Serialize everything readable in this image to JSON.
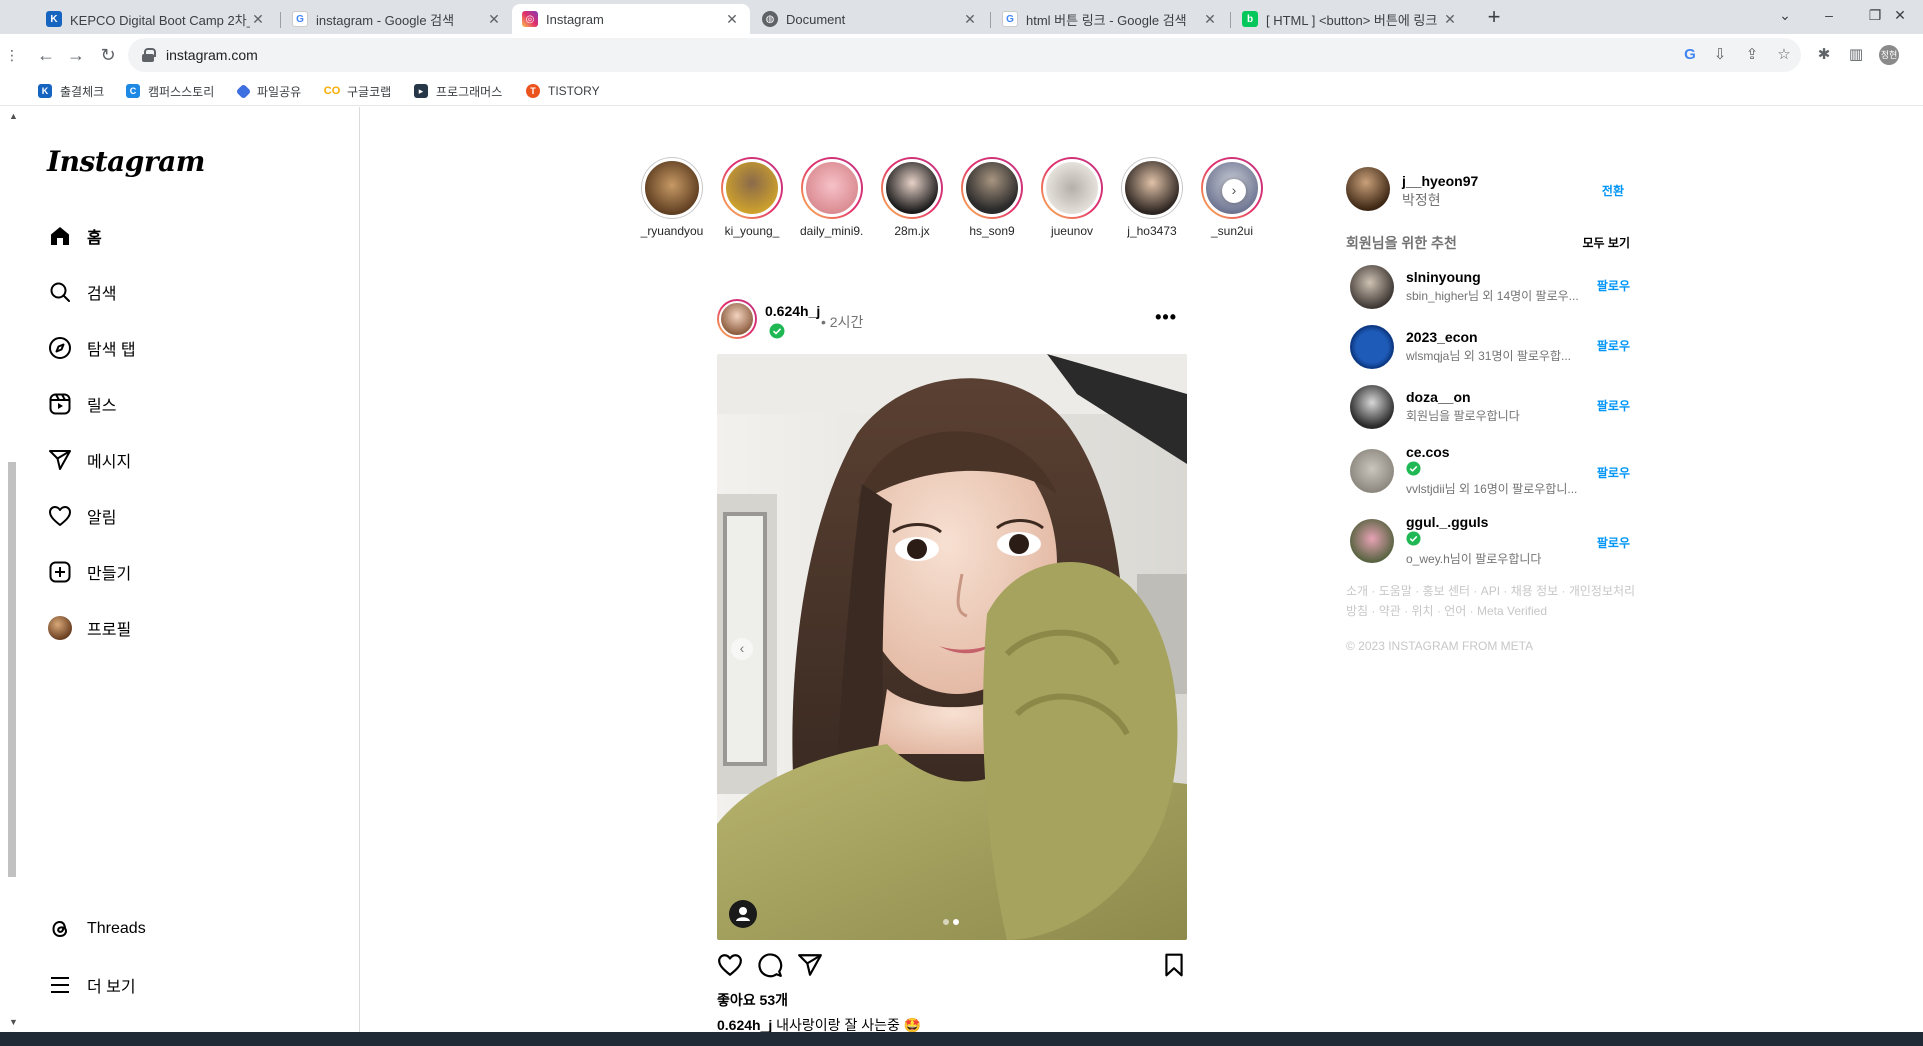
{
  "browser": {
    "tabs": [
      {
        "title": "KEPCO Digital Boot Camp 2차_",
        "icon": "kepco-icon",
        "color": "#1565c0"
      },
      {
        "title": "instagram - Google 검색",
        "icon": "google-icon",
        "color": "#4285f4"
      },
      {
        "title": "Instagram",
        "icon": "instagram-icon",
        "color": "#e1306c"
      },
      {
        "title": "Document",
        "icon": "globe-icon",
        "color": "#5f6368"
      },
      {
        "title": "html 버튼 링크 - Google 검색",
        "icon": "google-icon",
        "color": "#4285f4"
      },
      {
        "title": "[ HTML ] <button> 버튼에 링크",
        "icon": "blog-icon",
        "color": "#03c75a"
      }
    ],
    "url": "instagram.com",
    "bookmarks": [
      {
        "label": "출결체크",
        "color": "#1565c0"
      },
      {
        "label": "캠퍼스스토리",
        "color": "#1e88e5"
      },
      {
        "label": "파일공유",
        "color": "#3d6fe0"
      },
      {
        "label": "구글코랩",
        "color": "#f9ab00"
      },
      {
        "label": "프로그래머스",
        "color": "#263747"
      },
      {
        "label": "TISTORY",
        "color": "#eb531f"
      }
    ]
  },
  "sidebar": {
    "logo": "Instagram",
    "nav": [
      {
        "label": "홈",
        "icon": "home-icon"
      },
      {
        "label": "검색",
        "icon": "search-icon"
      },
      {
        "label": "탐색 탭",
        "icon": "compass-icon"
      },
      {
        "label": "릴스",
        "icon": "reels-icon"
      },
      {
        "label": "메시지",
        "icon": "send-icon"
      },
      {
        "label": "알림",
        "icon": "heart-icon"
      },
      {
        "label": "만들기",
        "icon": "plus-square-icon"
      },
      {
        "label": "프로필",
        "icon": "avatar"
      }
    ],
    "bottom": [
      {
        "label": "Threads",
        "icon": "threads-icon"
      },
      {
        "label": "더 보기",
        "icon": "menu-icon"
      }
    ]
  },
  "stories": [
    {
      "name": "_ryuandyou",
      "seen": true
    },
    {
      "name": "ki_young_",
      "seen": false
    },
    {
      "name": "daily_mini9...",
      "seen": false
    },
    {
      "name": "28m.jx",
      "seen": false
    },
    {
      "name": "hs_son9",
      "seen": false
    },
    {
      "name": "jueunov",
      "seen": false
    },
    {
      "name": "j_ho3473",
      "seen": true
    },
    {
      "name": "_sun2ui",
      "seen": false
    }
  ],
  "post": {
    "username": "0.624h_j",
    "time": "• 2시간",
    "likes": "좋아요 53개",
    "caption_user": "0.624h_j",
    "caption_text": "내사랑이랑 잘 사는중 🤩"
  },
  "right": {
    "me": {
      "username": "j__hyeon97",
      "name": "박정현",
      "switch": "전환"
    },
    "suggestions_title": "회원님을 위한 추천",
    "see_all": "모두 보기",
    "suggestions": [
      {
        "username": "slninyoung",
        "sub": "sbin_higher님 외 14명이 팔로우...",
        "verified": false,
        "follow": "팔로우"
      },
      {
        "username": "2023_econ",
        "sub": "wlsmqja님 외 31명이 팔로우합...",
        "verified": false,
        "follow": "팔로우"
      },
      {
        "username": "doza__on",
        "sub": "회원님을 팔로우합니다",
        "verified": false,
        "follow": "팔로우"
      },
      {
        "username": "ce.cos",
        "sub": "vvlstjdii님 외 16명이 팔로우합니...",
        "verified": true,
        "follow": "팔로우"
      },
      {
        "username": "ggul._.gguls",
        "sub": "o_wey.h님이 팔로우합니다",
        "verified": true,
        "follow": "팔로우"
      }
    ],
    "footer": "소개 · 도움말 · 홍보 센터 · API · 채용 정보 · 개인정보처리방침 · 약관 · 위치 · 언어 · Meta Verified",
    "copyright": "© 2023 INSTAGRAM FROM META"
  },
  "colors": {
    "accent": "#0095f6",
    "verified": "#20b855"
  }
}
